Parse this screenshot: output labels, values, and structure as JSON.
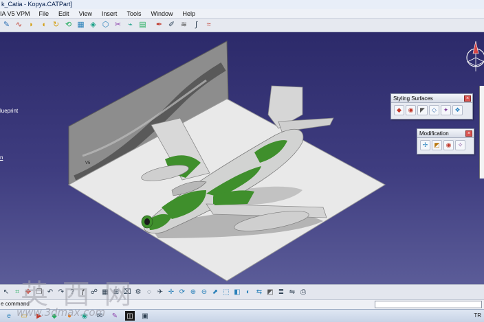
{
  "window": {
    "title": "k_Catia - Kopya.CATPart]"
  },
  "menubar": {
    "app_label": "IA V5 VPM",
    "items": [
      "File",
      "Edit",
      "View",
      "Insert",
      "Tools",
      "Window",
      "Help"
    ]
  },
  "tree": {
    "label_blueprint": "lueprint",
    "label_link": "n"
  },
  "panels": {
    "styling_surfaces": {
      "title": "Styling Surfaces"
    },
    "modification": {
      "title": "Modification"
    }
  },
  "status": {
    "command_label": "e command"
  },
  "watermark": {
    "text": "英 西 网",
    "url": "www.3dmax.com"
  },
  "tray": {
    "lang": "TR"
  },
  "colors": {
    "viewport_top": "#2c2a6a",
    "viewport_bottom": "#5b5c98",
    "camo_green": "#3f8f2c",
    "airframe_grey": "#cfd0cf"
  },
  "icons": {
    "compass": "compass-icon",
    "close": "close-icon"
  }
}
